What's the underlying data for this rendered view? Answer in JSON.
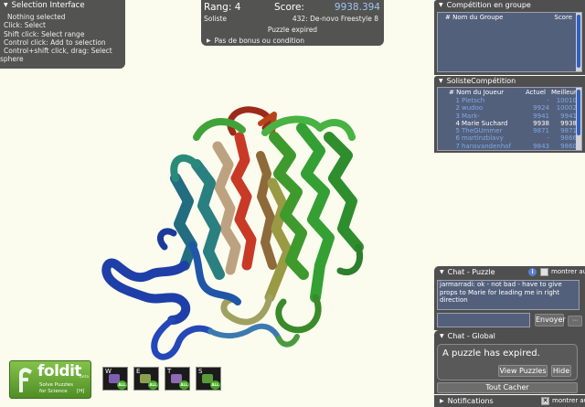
{
  "selection_panel": {
    "title": "Selection Interface",
    "lines": [
      "Nothing selected",
      "Click: Select",
      "Shift click: Select range",
      "Control click: Add to selection",
      "Control+shift click, drag: Select",
      "sphere"
    ]
  },
  "score_panel": {
    "rank_label": "Rang: 4",
    "score_label": "Score:",
    "score_value": "9938.394",
    "role": "Soliste",
    "puzzle_name": "432: De-novo Freestyle 8",
    "status": "Puzzle expired",
    "bonus": "Pas de bonus ou condition"
  },
  "group_competition": {
    "title": "Compétition en groupe",
    "col_name": "# Nom du Groupe",
    "col_score": "Score"
  },
  "solo_competition": {
    "title": "SolisteCompétition",
    "col_name": "# Nom du Joueur",
    "col_current": "Actuel",
    "col_best": "Meilleur",
    "rows": [
      {
        "rank": "1",
        "name": "Pletsch",
        "current": "-",
        "best": "10010"
      },
      {
        "rank": "2",
        "name": "wudoo",
        "current": "9924",
        "best": "10002"
      },
      {
        "rank": "3",
        "name": "Mark-",
        "current": "9941",
        "best": "9941"
      },
      {
        "rank": "4",
        "name": "Marie Suchard",
        "current": "9938",
        "best": "9938"
      },
      {
        "rank": "5",
        "name": "TheGUmmer",
        "current": "9871",
        "best": "9871"
      },
      {
        "rank": "6",
        "name": "martinzblavy",
        "current": "-",
        "best": "9866"
      },
      {
        "rank": "7",
        "name": "hansvandenhof",
        "current": "9843",
        "best": "9860"
      }
    ]
  },
  "chat_puzzle": {
    "title": "Chat - Puzzle",
    "show_label": "montrer aut",
    "log_lines": [
      "jarmarradi: ok - not bad - have to give",
      "props to Marie for leading me in right",
      "direction"
    ],
    "input_value": "",
    "send_label": "Envoyer",
    "menu_glyph": "⋯"
  },
  "chat_global": {
    "title": "Chat - Global",
    "message": "A puzzle has expired.",
    "view_puzzles_label": "View Puzzles",
    "hide_label": "Hide",
    "hide_all_label": "Tout Cacher"
  },
  "notifications": {
    "title": "Notifications",
    "check_glyph": "✕",
    "show_label": "montrer aut"
  },
  "logo": {
    "word": "foldit",
    "beta": "beta",
    "tagline1": "Solve Puzzles",
    "tagline2": "for Science",
    "badge": "[H]"
  },
  "toolbar": {
    "all_label": "ALL",
    "buttons": [
      {
        "letter": "W"
      },
      {
        "letter": "E"
      },
      {
        "letter": "T"
      },
      {
        "letter": "S"
      }
    ]
  },
  "colors": {
    "background": "#fbfbee",
    "panel": "#464646",
    "list": "#53607b",
    "score_value": "#9ec4f0",
    "other_player": "#7fa8e8",
    "logo_green": "#6aa83a"
  },
  "icons": {
    "collapse": "triangle-down-icon",
    "expand": "triangle-right-icon",
    "info": "info-icon",
    "protein": "protein-cartoon-model"
  }
}
